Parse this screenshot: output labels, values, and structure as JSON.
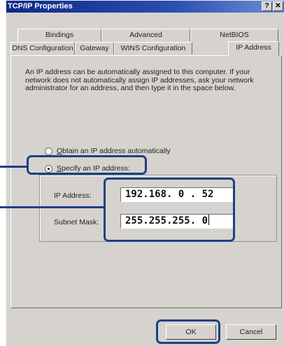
{
  "window": {
    "title": "TCP/IP Properties",
    "help_btn": "?",
    "close_btn": "✕"
  },
  "tabs": {
    "row1": [
      "Bindings",
      "Advanced",
      "NetBIOS"
    ],
    "row2": [
      "DNS Configuration",
      "Gateway",
      "WINS Configuration",
      "IP Address"
    ],
    "active": "IP Address"
  },
  "description": "An IP address can be automatically assigned to this computer. If your network does not automatically assign IP addresses, ask your network administrator for an address, and then type it in the space below.",
  "options": {
    "auto_prefix": "O",
    "auto_rest": "btain an IP address automatically",
    "specify_prefix": "S",
    "specify_rest": "pecify an IP address:",
    "selected": "specify"
  },
  "fields": {
    "ip_label": "IP Address:",
    "ip_value": "192.168. 0 . 52",
    "mask_label": "Subnet Mask:",
    "mask_value": "255.255.255. 0"
  },
  "buttons": {
    "ok": "OK",
    "cancel": "Cancel"
  },
  "colors": {
    "callout": "#1e3f86",
    "titlebar": "#0b2a86",
    "dialog_bg": "#d6d3ce"
  }
}
